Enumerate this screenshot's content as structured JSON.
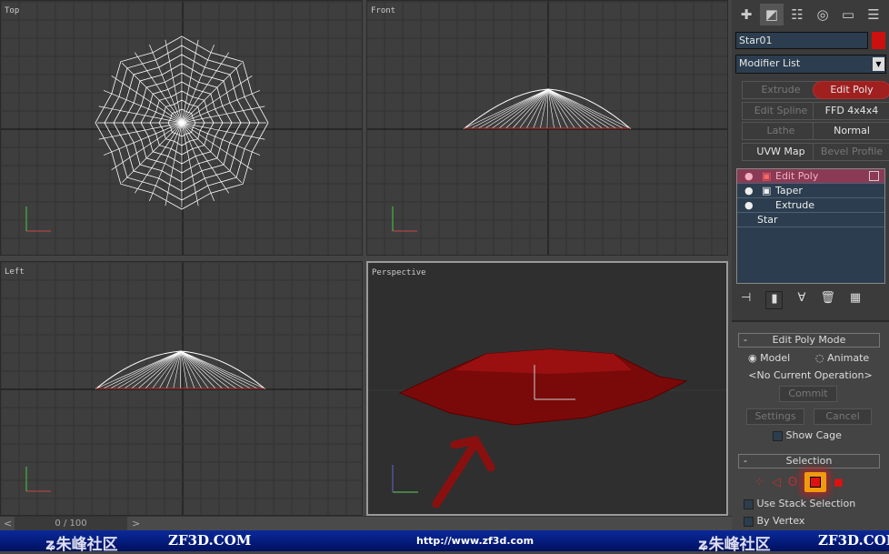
{
  "viewports": [
    {
      "label": "Top"
    },
    {
      "label": "Front"
    },
    {
      "label": "Left"
    },
    {
      "label": "Perspective"
    }
  ],
  "command_panel": {
    "tabs": [
      "create-icon",
      "modify-icon",
      "hierarchy-icon",
      "motion-icon",
      "display-icon",
      "utilities-icon"
    ],
    "object_name": "Star01",
    "object_color": "#cc1010",
    "modifier_list": "Modifier List",
    "modifier_buttons": [
      "Extrude",
      "Edit Poly",
      "Edit Spline",
      "FFD 4x4x4",
      "Lathe",
      "Normal",
      "UVW Map",
      "Bevel Profile"
    ],
    "stack": [
      "Edit Poly",
      "Taper",
      "Extrude",
      "Star"
    ],
    "edit_poly_mode": {
      "title": "Edit Poly Mode",
      "model": "Model",
      "animate": "Animate",
      "operation": "<No Current Operation>",
      "commit": "Commit",
      "settings": "Settings",
      "cancel": "Cancel",
      "show_cage": "Show Cage"
    },
    "selection": {
      "title": "Selection",
      "use_stack": "Use Stack Selection",
      "by_vertex": "By Vertex"
    }
  },
  "timeline": {
    "frame": "0 / 100",
    "prev": "<",
    "next": ">"
  },
  "footer": {
    "brand_cn": "朱峰社区",
    "brand": "ZF3D.COM",
    "url": "http://www.zf3d.com"
  },
  "accent": "#cc1010"
}
